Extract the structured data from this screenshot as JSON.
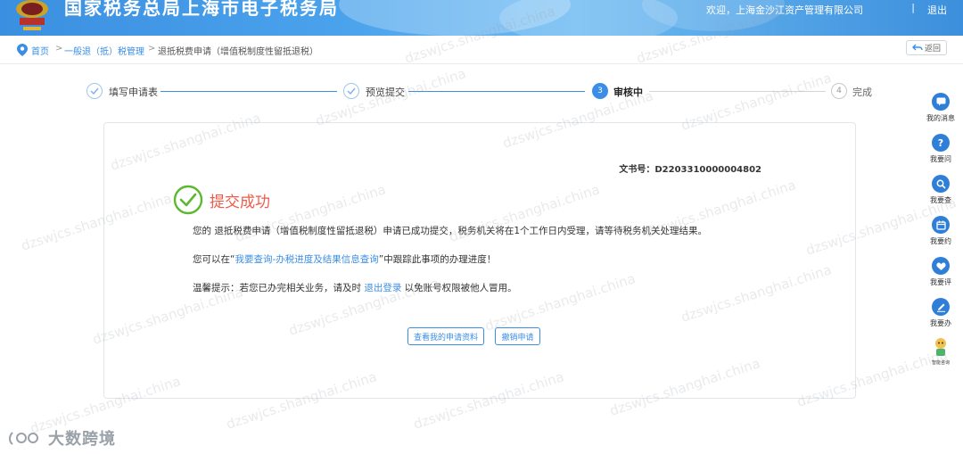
{
  "header": {
    "title": "国家税务总局上海市电子税务局",
    "welcome": "欢迎，上海金沙江资产管理有限公司",
    "separator": "|",
    "logout": "退出"
  },
  "breadcrumb": {
    "items": [
      "首页",
      "一般退（抵）税管理",
      "退抵税费申请（增值税制度性留抵退税）"
    ],
    "separator": ">",
    "back_label": "返回"
  },
  "steps": [
    {
      "label": "填写申请表",
      "status": "done"
    },
    {
      "label": "预览提交",
      "status": "done"
    },
    {
      "label": "审核中",
      "status": "active",
      "number": "3"
    },
    {
      "label": "完成",
      "status": "todo",
      "number": "4"
    }
  ],
  "content": {
    "doc_number": "文书号：D2203310000004802",
    "success_title": "提交成功",
    "line1": "您的 退抵税费申请（增值税制度性留抵退税）申请已成功提交，税务机关将在1个工作日内受理，请等待税务机关处理结果。",
    "line2_prefix": "您可以在“",
    "line2_link": "我要查询-办税进度及结果信息查询",
    "line2_suffix": "”中跟踪此事项的办理进度！",
    "line3_prefix": "温馨提示：若您已办完相关业务，请及时 ",
    "line3_link": "退出登录",
    "line3_suffix": " 以免账号权限被他人冒用。",
    "btn_view": "查看我的申请资料",
    "btn_revoke": "撤销申请"
  },
  "sidebar": [
    {
      "label": "我的消息",
      "icon": "message-icon"
    },
    {
      "label": "我要问",
      "icon": "question-icon"
    },
    {
      "label": "我要查",
      "icon": "search-icon"
    },
    {
      "label": "我要约",
      "icon": "calendar-icon"
    },
    {
      "label": "我要评",
      "icon": "rate-icon"
    },
    {
      "label": "我要办",
      "icon": "edit-icon"
    },
    {
      "label": "智能咨询",
      "icon": "robot-icon"
    }
  ],
  "watermark": "dzswjcs.shanghai.china",
  "bottom_brand": "大数跨境",
  "colors": {
    "primary": "#3a8ee6",
    "success": "#5cb82e",
    "success_title": "#ee5b4a",
    "header": "#4aa2ec"
  }
}
